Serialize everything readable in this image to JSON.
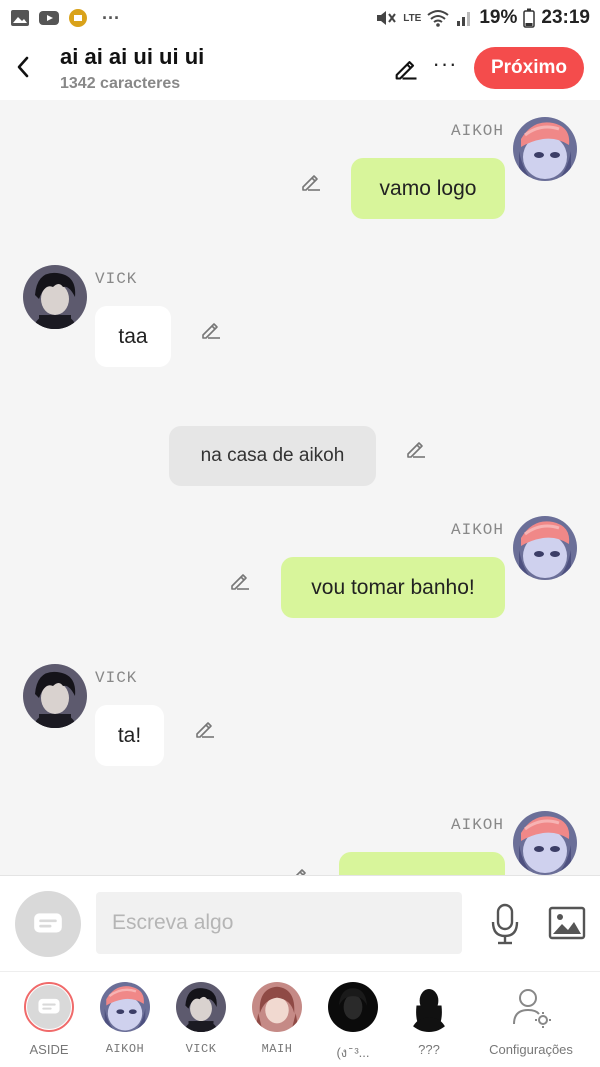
{
  "status_bar": {
    "battery": "19%",
    "time": "23:19",
    "more": "···",
    "network": "LTE"
  },
  "header": {
    "title": "ai ai ai ui ui ui",
    "subtitle": "1342 caracteres",
    "next_label": "Próximo",
    "more": "···"
  },
  "messages": [
    {
      "speaker": "AIKOH",
      "text": "vamo logo",
      "style": "green",
      "side": "right"
    },
    {
      "speaker": "VICK",
      "text": "taa",
      "style": "white",
      "side": "left"
    },
    {
      "speaker": "",
      "text": "na casa de aikoh",
      "style": "grey",
      "side": "center"
    },
    {
      "speaker": "AIKOH",
      "text": "vou tomar banho!",
      "style": "green",
      "side": "right"
    },
    {
      "speaker": "VICK",
      "text": "ta!",
      "style": "white",
      "side": "left"
    },
    {
      "speaker": "AIKOH",
      "text": "",
      "style": "green",
      "side": "right"
    }
  ],
  "input": {
    "placeholder": "Escreva algo"
  },
  "characters": [
    {
      "label": "ASIDE"
    },
    {
      "label": "AIKOH"
    },
    {
      "label": "VICK"
    },
    {
      "label": "MAIH"
    },
    {
      "label": "(ง ̄ ³..."
    },
    {
      "label": "???"
    },
    {
      "label": "Configurações"
    }
  ],
  "colors": {
    "accent": "#f44c4c",
    "bubble_green": "#d8f59b",
    "bubble_white": "#ffffff",
    "bubble_grey": "#e6e6e6",
    "background": "#f5f5f5"
  }
}
